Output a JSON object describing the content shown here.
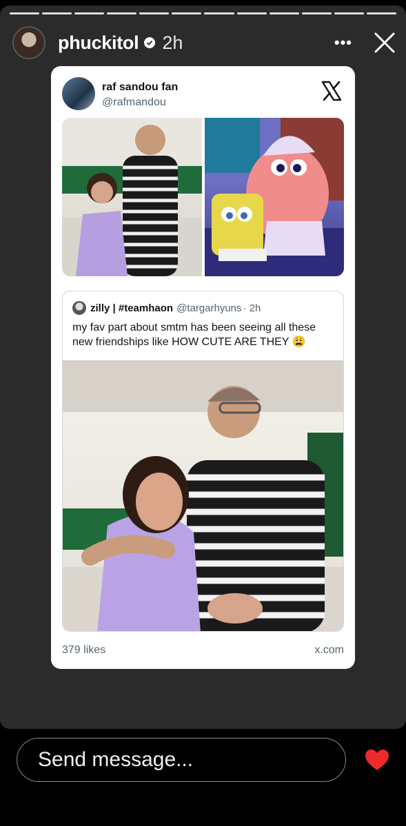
{
  "story": {
    "progress_segments": 12,
    "username": "phuckitol",
    "time": "2h",
    "more_icon": "more-horizontal-icon",
    "close_icon": "close-icon"
  },
  "post": {
    "author_name": "raf sandou fan",
    "author_handle": "@rafmandou",
    "platform_icon": "x-logo-icon",
    "quote": {
      "name": "zilly | #teamhaon",
      "handle": "@targarhyuns",
      "time": "· 2h",
      "text": "my fav part about smtm has been seeing all these new friendships like HOW CUTE ARE THEY 😩"
    },
    "likes": "379 likes",
    "source": "x.com"
  },
  "footer": {
    "message_placeholder": "Send message...",
    "like_icon": "heart-icon",
    "like_color": "#ed2a2a"
  }
}
